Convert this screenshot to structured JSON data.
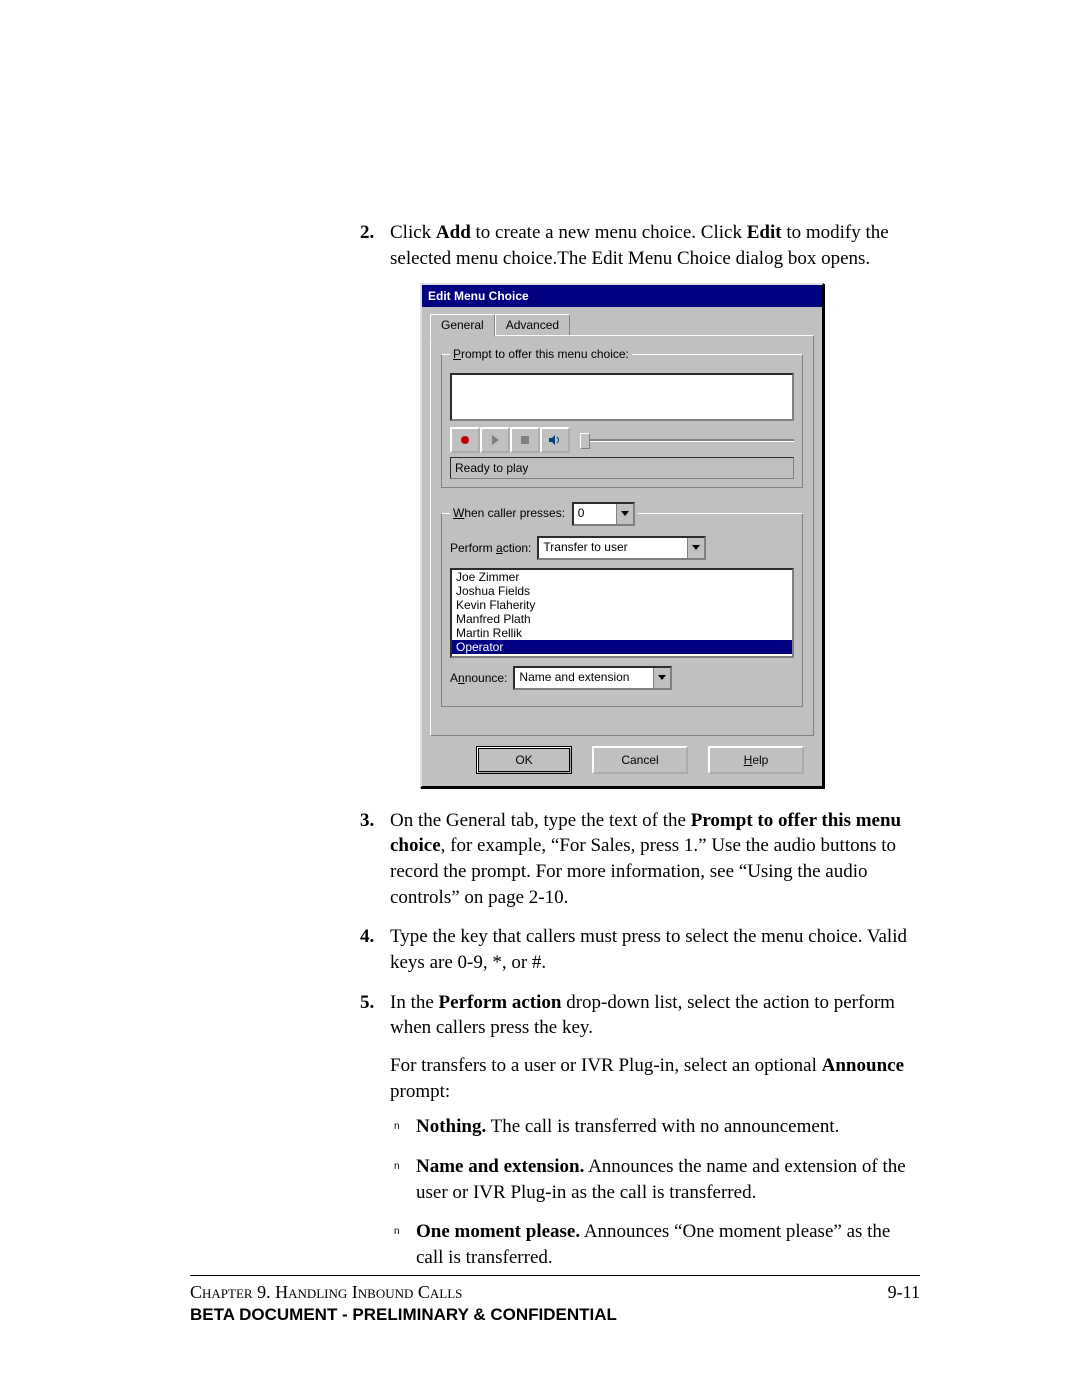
{
  "steps": {
    "s2": {
      "num": "2.",
      "t1a": "Click ",
      "t1b": "Add",
      "t1c": " to create a new menu choice. Click ",
      "t1d": "Edit",
      "t1e": " to modify the selected menu choice.The Edit Menu Choice dialog box opens."
    },
    "s3": {
      "num": "3.",
      "t1a": "On the General tab, type the text of the ",
      "t1b": "Prompt to offer this menu choice",
      "t1c": ", for example, “For Sales, press 1.” Use the audio buttons to record the prompt. For more information, see “Using the audio controls” on page 2-10."
    },
    "s4": {
      "num": "4.",
      "t": "Type the key that callers must press to select the menu choice. Valid keys are 0-9, *, or #."
    },
    "s5": {
      "num": "5.",
      "t1a": "In the ",
      "t1b": "Perform action",
      "t1c": " drop-down list, select the action to perform when callers press the key.",
      "t2a": "For transfers to a user or IVR Plug-in, select an optional ",
      "t2b": "Announce",
      "t2c": " prompt:"
    }
  },
  "bullets": {
    "marker": "n",
    "b1a": "Nothing.",
    "b1b": " The call is transferred with no announcement.",
    "b2a": "Name and extension.",
    "b2b": " Announces the name and extension of the user or IVR Plug-in as the call is transferred.",
    "b3a": "One moment please.",
    "b3b": " Announces “One moment please” as the call is transferred."
  },
  "dialog": {
    "title": "Edit Menu Choice",
    "tab_general": "General",
    "tab_advanced": "Advanced",
    "group1_legend_pre": "",
    "group1_p": "P",
    "group1_rest": "rompt to offer this menu choice:",
    "status": "Ready to play",
    "group2_w": "W",
    "group2_rest": "hen caller presses:",
    "caller_value": "0",
    "perform_a": "a",
    "perform_pre": "Perform ",
    "perform_post": "ction:",
    "perform_value": "Transfer to user",
    "list": [
      "Joe Zimmer",
      "Joshua Fields",
      "Kevin Flaherity",
      "Manfred Plath",
      "Martin Rellik",
      "Operator"
    ],
    "list_selected_index": 5,
    "announce_n": "n",
    "announce_pre": "A",
    "announce_post": "nounce:",
    "announce_value": "Name and extension",
    "ok": "OK",
    "cancel": "Cancel",
    "help_h": "H",
    "help_rest": "elp"
  },
  "footer": {
    "chapter": "Chapter 9. Handling Inbound Calls",
    "page": "9-11",
    "banner": "BETA DOCUMENT - PRELIMINARY & CONFIDENTIAL"
  }
}
